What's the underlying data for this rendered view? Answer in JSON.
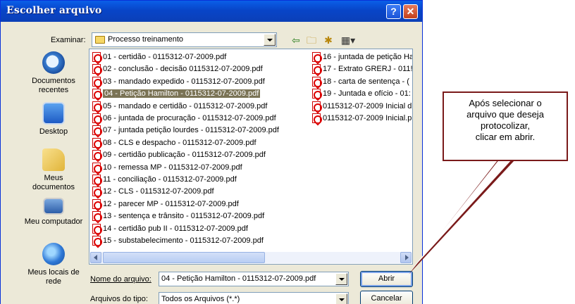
{
  "dialog": {
    "title": "Escolher arquivo",
    "help_glyph": "?",
    "close_glyph": "✕"
  },
  "lookin": {
    "label": "Examinar:",
    "value": "Processo treinamento"
  },
  "places": [
    {
      "label": "Documentos recentes",
      "icon": "recent-documents-icon"
    },
    {
      "label": "Desktop",
      "icon": "desktop-icon"
    },
    {
      "label": "Meus documentos",
      "icon": "my-documents-icon"
    },
    {
      "label": "Meu computador",
      "icon": "my-computer-icon"
    },
    {
      "label": "Meus locais de rede",
      "icon": "network-places-icon"
    }
  ],
  "files_col1": [
    "01 - certidão - 0115312-07-2009.pdf",
    "02 - conclusão - decisão  0115312-07-2009.pdf",
    "03 - mandado expedido - 0115312-07-2009.pdf",
    "04 - Petição Hamilton - 0115312-07-2009.pdf",
    "05 - mandado e certidão - 0115312-07-2009.pdf",
    "06 - juntada de procuração - 0115312-07-2009.pdf",
    "07 - juntada petição lourdes - 0115312-07-2009.pdf",
    "08 - CLS e despacho - 0115312-07-2009.pdf",
    "09 - certidão publicação - 0115312-07-2009.pdf",
    "10 - remessa MP - 0115312-07-2009.pdf",
    "11 - conciliação - 0115312-07-2009.pdf",
    "12 - CLS - 0115312-07-2009.pdf",
    "12 - parecer MP - 0115312-07-2009.pdf",
    "13 - sentença e trânsito - 0115312-07-2009.pdf",
    "14 - certidão pub II - 0115312-07-2009.pdf",
    "15 - substabelecimento - 0115312-07-2009.pdf"
  ],
  "files_col2": [
    "16 - juntada de petição Ha",
    "17 - Extrato GRERJ - 011!",
    "18 - carta de sentença - (",
    "19 - Juntada e ofício - 01:",
    "0115312-07-2009 Inicial d",
    "0115312-07-2009 Inicial.p"
  ],
  "selected_index": 3,
  "filename": {
    "label": "Nome do arquivo:",
    "value": "04 - Petição Hamilton - 0115312-07-2009.pdf"
  },
  "filetype": {
    "label": "Arquivos do tipo:",
    "value": "Todos os Arquivos (*.*)"
  },
  "buttons": {
    "open": "Abrir",
    "cancel": "Cancelar"
  },
  "callout": {
    "text": "Após selecionar o\narquivo que deseja\nprotocolizar,\nclicar em abrir.",
    "border_color": "#7a1a1a"
  },
  "colors": {
    "titlebar": "#0a5fe8",
    "selection": "#7a7355",
    "dialog_bg": "#ece9d8"
  }
}
